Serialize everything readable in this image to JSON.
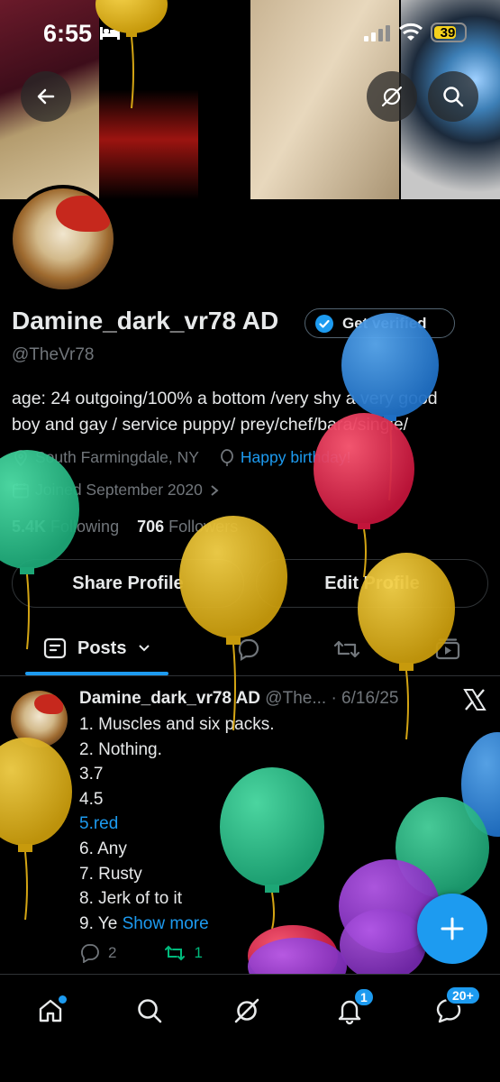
{
  "status_bar": {
    "time": "6:55",
    "battery": "39"
  },
  "profile": {
    "name": "Damine_dark_vr78 AD",
    "get_verified": "Get verified",
    "handle": "@TheVr78",
    "bio_line1": "age: 24 outgoing/100% a bottom /very shy a very good",
    "bio_line2": "boy and gay / service puppy/ prey/chef/bara/single/",
    "location": "South Farmingdale, NY",
    "birthday": "Happy birthday!",
    "joined": "Joined September 2020",
    "following_count": "5.4K",
    "following_label": "Following",
    "followers_count": "706",
    "followers_label": "Followers",
    "share_profile": "Share Profile",
    "edit_profile": "Edit Profile"
  },
  "tabs": {
    "posts": "Posts"
  },
  "post": {
    "author": "Damine_dark_vr78 AD",
    "handle_trunc": "@The...",
    "date": "· 6/16/25",
    "lines": [
      "1. Muscles and six packs.",
      "2. Nothing.",
      "3.7",
      "4.5",
      "5.red",
      "6. Any",
      "7. Rusty",
      "8. Jerk of to it",
      "9. Ye"
    ],
    "show_more": "Show more",
    "replies": "2",
    "reposts": "1"
  },
  "bottom_nav": {
    "notifications_badge": "1",
    "messages_badge": "20+"
  },
  "colors": {
    "accent": "#1d9bf0",
    "repost_green": "#00ba7c",
    "muted": "#71767b"
  }
}
